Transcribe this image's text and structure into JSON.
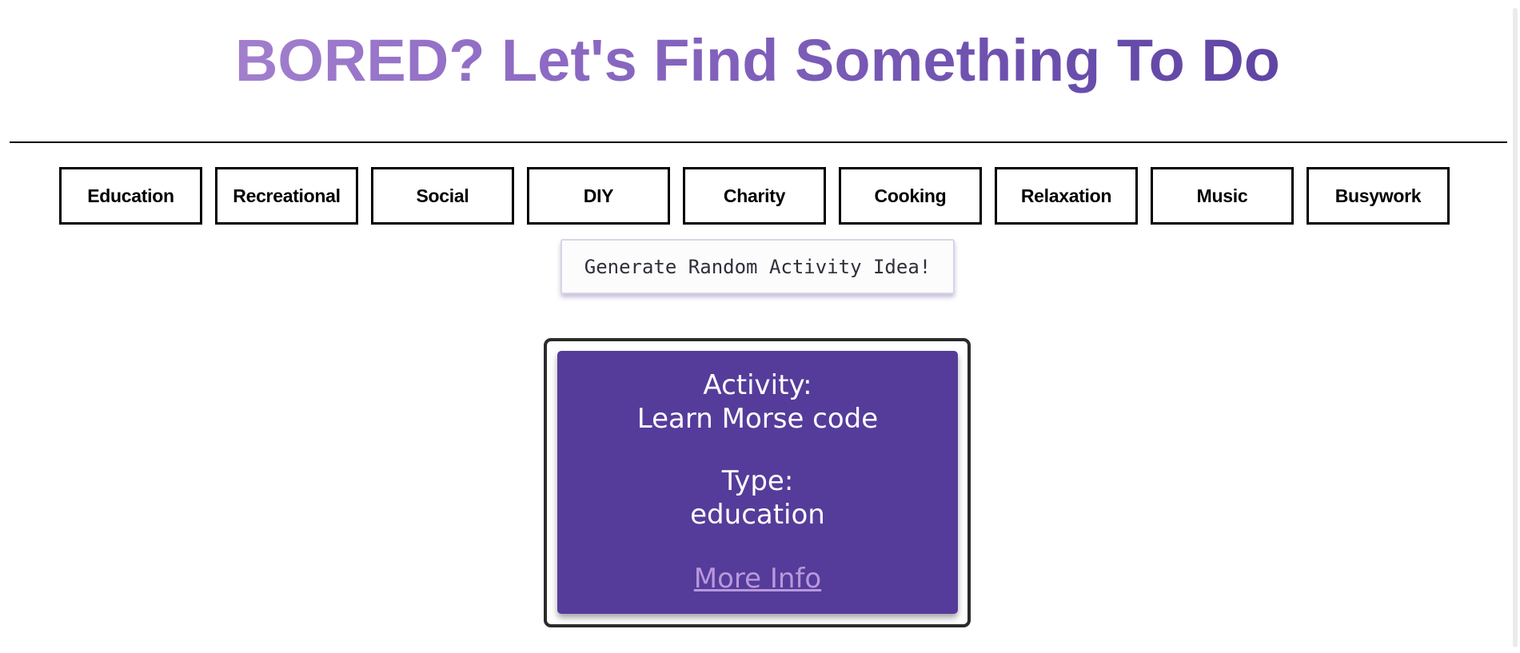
{
  "header": {
    "title": "BORED? Let's Find Something To Do"
  },
  "categories": [
    {
      "label": "Education"
    },
    {
      "label": "Recreational"
    },
    {
      "label": "Social"
    },
    {
      "label": "DIY"
    },
    {
      "label": "Charity"
    },
    {
      "label": "Cooking"
    },
    {
      "label": "Relaxation"
    },
    {
      "label": "Music"
    },
    {
      "label": "Busywork"
    }
  ],
  "generate": {
    "label": "Generate Random Activity Idea!"
  },
  "card": {
    "activity_label": "Activity:",
    "activity_value": "Learn Morse code",
    "type_label": "Type:",
    "type_value": "education",
    "more_info": "More Info"
  },
  "colors": {
    "title_gradient_start": "#b28fd4",
    "title_gradient_end": "#553b9c",
    "card_background": "#553c9a",
    "link": "#b898dc"
  }
}
